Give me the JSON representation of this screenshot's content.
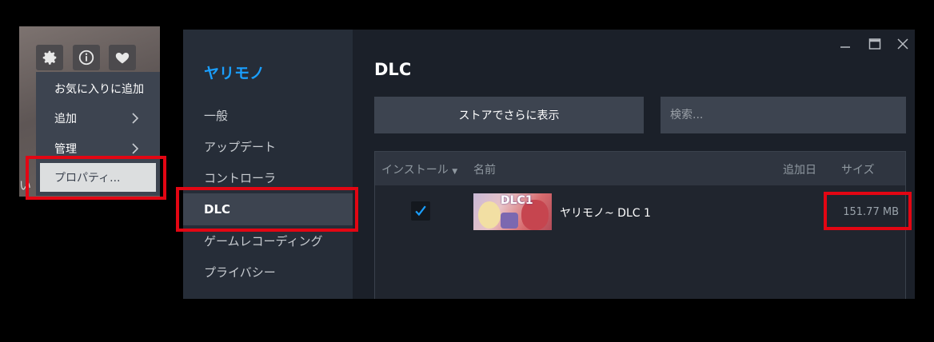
{
  "context": {
    "ghost_text": "い",
    "icons": [
      "gear-icon",
      "info-icon",
      "heart-icon"
    ],
    "menu_items": [
      {
        "label": "お気に入りに追加",
        "submenu": false
      },
      {
        "label": "追加",
        "submenu": true
      },
      {
        "label": "管理",
        "submenu": true
      },
      {
        "label": "プロパティ...",
        "submenu": false,
        "selected": true
      }
    ]
  },
  "window": {
    "controls": [
      "minimize-icon",
      "maximize-icon",
      "close-icon"
    ],
    "sidebar": {
      "title": "ヤリモノ",
      "items": [
        "一般",
        "アップデート",
        "コントローラ",
        "DLC",
        "ゲームレコーディング",
        "プライバシー"
      ],
      "active": "DLC"
    },
    "main": {
      "title": "DLC",
      "store_button": "ストアでさらに表示",
      "search_placeholder": "検索...",
      "table": {
        "headers": {
          "install": "インストール",
          "name": "名前",
          "added": "追加日",
          "size": "サイズ"
        },
        "rows": [
          {
            "installed": true,
            "thumb_text": "DLC1",
            "name": "ヤリモノ~ DLC 1",
            "size": "151.77 MB"
          }
        ]
      }
    }
  },
  "colors": {
    "accent": "#1a9fff",
    "highlight": "#e30613",
    "panel": "#3d4450",
    "window_bg": "#1b2029"
  }
}
